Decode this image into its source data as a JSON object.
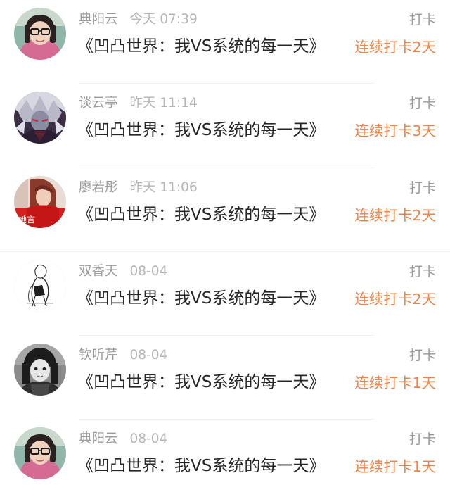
{
  "accent_color": "#f0834a",
  "feed": {
    "items": [
      {
        "user": "典阳云",
        "time": "今天 07:39",
        "title": "《凹凸世界：我VS系统的每一天》",
        "action_label": "打卡",
        "streak": "连续打卡2天",
        "avatar_icon": "woman-with-glasses-avatar"
      },
      {
        "user": "谈云亭",
        "time": "昨天 11:14",
        "title": "《凹凸世界：我VS系统的每一天》",
        "action_label": "打卡",
        "streak": "连续打卡3天",
        "avatar_icon": "anime-character-avatar"
      },
      {
        "user": "廖若彤",
        "time": "昨天 11:06",
        "title": "《凹凸世界：我VS系统的每一天》",
        "action_label": "打卡",
        "streak": "连续打卡2天",
        "avatar_icon": "red-portrait-avatar",
        "avatar_caption": "她言"
      },
      {
        "user": "双香天",
        "time": "08-04",
        "title": "《凹凸世界：我VS系统的每一天》",
        "action_label": "打卡",
        "streak": "连续打卡2天",
        "avatar_icon": "sketch-figure-avatar"
      },
      {
        "user": "钦听芹",
        "time": "08-04",
        "title": "《凹凸世界：我VS系统的每一天》",
        "action_label": "打卡",
        "streak": "连续打卡1天",
        "avatar_icon": "grayscale-girl-avatar"
      },
      {
        "user": "典阳云",
        "time": "08-04",
        "title": "《凹凸世界：我VS系统的每一天》",
        "action_label": "打卡",
        "streak": "连续打卡1天",
        "avatar_icon": "woman-with-glasses-avatar"
      }
    ]
  }
}
